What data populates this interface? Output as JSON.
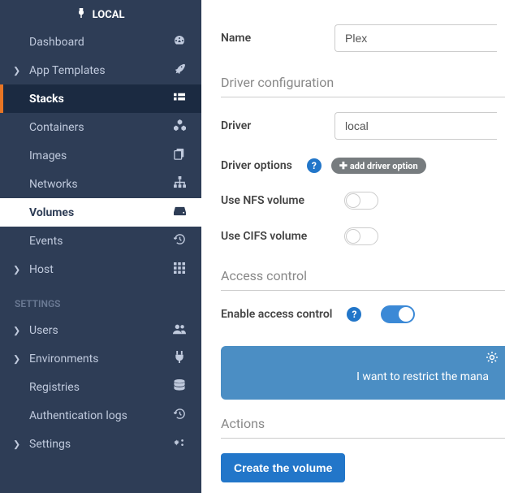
{
  "sidebar": {
    "header": "LOCAL",
    "items": [
      {
        "label": "Dashboard",
        "icon": "dashboard"
      },
      {
        "label": "App Templates",
        "icon": "rocket",
        "chevron": true
      },
      {
        "label": "Stacks",
        "icon": "grid",
        "active": true
      },
      {
        "label": "Containers",
        "icon": "cubes"
      },
      {
        "label": "Images",
        "icon": "copy"
      },
      {
        "label": "Networks",
        "icon": "sitemap"
      },
      {
        "label": "Volumes",
        "icon": "hdd",
        "selected": true
      },
      {
        "label": "Events",
        "icon": "history"
      },
      {
        "label": "Host",
        "icon": "th",
        "chevron": true
      }
    ],
    "section": "SETTINGS",
    "settings": [
      {
        "label": "Users",
        "icon": "users",
        "chevron": true
      },
      {
        "label": "Environments",
        "icon": "plug",
        "chevron": true
      },
      {
        "label": "Registries",
        "icon": "database"
      },
      {
        "label": "Authentication logs",
        "icon": "history"
      },
      {
        "label": "Settings",
        "icon": "cogs",
        "chevron": true
      }
    ]
  },
  "form": {
    "name_label": "Name",
    "name_value": "Plex",
    "driver_config_title": "Driver configuration",
    "driver_label": "Driver",
    "driver_value": "local",
    "driver_options_label": "Driver options",
    "add_option_label": "add driver option",
    "nfs_label": "Use NFS volume",
    "cifs_label": "Use CIFS volume",
    "access_control_title": "Access control",
    "enable_access_label": "Enable access control",
    "banner_text": "I want to restrict the mana",
    "actions_title": "Actions",
    "create_btn": "Create the volume"
  }
}
